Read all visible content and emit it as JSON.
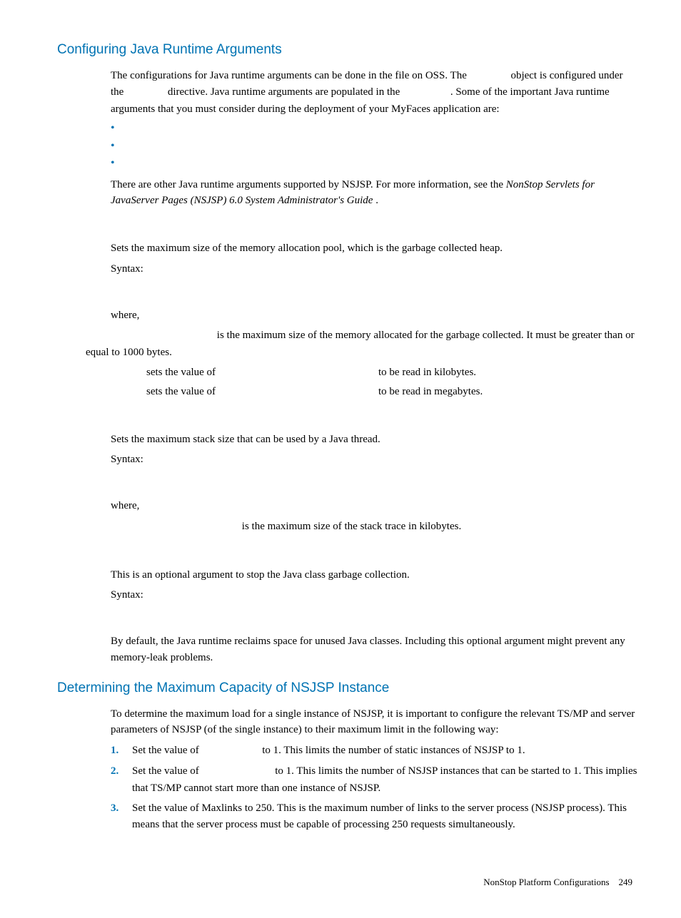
{
  "section1": {
    "heading": "Configuring Java Runtime Arguments",
    "p1_a": "The configurations for Java runtime arguments can be done in the ",
    "p1_b": " file on OSS. The ",
    "p1_c": " object is configured under the ",
    "p1_d": " directive. Java runtime arguments are populated in the ",
    "p1_e": ". Some of the important Java runtime arguments that you must consider during the deployment of your MyFaces application are:",
    "p2": "There are other Java runtime arguments supported by NSJSP. For more information, see the ",
    "p2_italic": "NonStop Servlets for JavaServer Pages (NSJSP) 6.0 System Administrator's Guide",
    "p2_end": ".",
    "xmx": {
      "desc": "Sets the maximum size of the memory allocation pool, which is the garbage collected heap.",
      "syntax_label": "Syntax:",
      "where": "where,",
      "where_desc_a": " is the maximum size of the memory allocated for the garbage collected.",
      "where_desc_b": "It must be greater than or equal to 1000 bytes.",
      "k_mid": " sets the value of ",
      "k_end": " to be read in kilobytes.",
      "m_mid": " sets the value of ",
      "m_end": " to be read in megabytes."
    },
    "xss": {
      "desc": "Sets the maximum stack size that can be used by a Java thread.",
      "syntax_label": "Syntax:",
      "where": "where,",
      "where_desc": " is the maximum size of the stack trace in kilobytes."
    },
    "xnoclassgc": {
      "desc": "This is an optional argument to stop the Java class garbage collection.",
      "syntax_label": "Syntax:",
      "p": "By default, the Java runtime reclaims space for unused Java classes. Including this optional argument might prevent any memory-leak problems."
    }
  },
  "section2": {
    "heading": "Determining the Maximum Capacity of NSJSP Instance",
    "p1": "To determine the maximum load for a single instance of NSJSP, it is important to configure the relevant TS/MP and server parameters of NSJSP (of the single instance) to their maximum limit in the following way:",
    "steps": {
      "s1_a": "Set the value of ",
      "s1_b": " to 1. This limits the number of static instances of NSJSP to 1.",
      "s2_a": "Set the value of ",
      "s2_b": " to 1. This limits the number of NSJSP instances that can be started to 1. This implies that TS/MP cannot start more than one instance of NSJSP.",
      "s3": "Set the value of Maxlinks to 250. This is the maximum number of links to the server process (NSJSP process). This means that the server process must be capable of processing 250 requests simultaneously.",
      "n1": "1.",
      "n2": "2.",
      "n3": "3."
    }
  },
  "footer": {
    "text": "NonStop Platform Configurations",
    "page": "249"
  }
}
